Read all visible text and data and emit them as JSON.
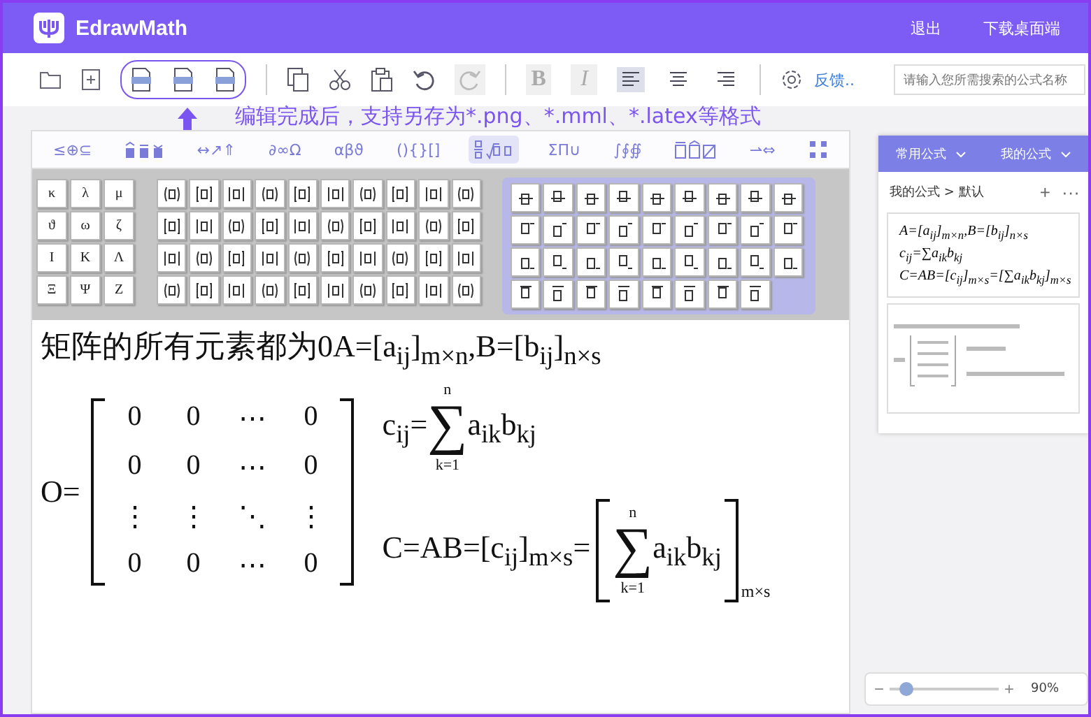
{
  "header": {
    "app_name": "EdrawMath",
    "links": [
      "退出",
      "下载桌面端"
    ]
  },
  "toolbar": {
    "redo_disabled": true,
    "text_styles": [
      {
        "label": "B",
        "disabled": true
      },
      {
        "label": "I",
        "disabled": true
      }
    ],
    "alignments": [
      {
        "kind": "left",
        "selected": true
      },
      {
        "kind": "center",
        "selected": false
      },
      {
        "kind": "right",
        "selected": false
      }
    ],
    "feedback_link": "反馈..",
    "search": {
      "placeholder": "请输入您所需搜索的公式名称"
    }
  },
  "annotation": "编辑完成后，支持另存为*.png、*.mml、*.latex等格式",
  "palette": {
    "tabs": [
      {
        "kind": "text",
        "label": "≤⊕⊆",
        "selected": false
      },
      {
        "kind": "accent",
        "selected": false
      },
      {
        "kind": "text",
        "label": "↔↗⇑",
        "selected": false
      },
      {
        "kind": "text",
        "label": "∂∞Ω",
        "selected": false
      },
      {
        "kind": "text",
        "label": "αβϑ",
        "selected": false
      },
      {
        "kind": "text",
        "label": "(){}[]",
        "selected": false
      },
      {
        "kind": "fraction",
        "selected": true
      },
      {
        "kind": "text",
        "label": "ΣΠ∪",
        "selected": false
      },
      {
        "kind": "text",
        "label": "∫∮∯",
        "selected": false
      },
      {
        "kind": "box",
        "selected": false
      },
      {
        "kind": "text",
        "label": "⇀⇔",
        "selected": false
      },
      {
        "kind": "matrix",
        "selected": false
      }
    ],
    "greek": [
      "κ",
      "λ",
      "μ",
      "ϑ",
      "ω",
      "ζ",
      "Ι",
      "Κ",
      "Λ",
      "Ξ",
      "Ψ",
      "Ζ"
    ]
  },
  "formula": {
    "line1": "矩阵的所有元素都为0A=[a$_{ij}$]$_{m×n}$,B=[b$_{ij}$]$_{n×s}$",
    "matrix_label": "O=",
    "matrix_rows": [
      [
        "0",
        "0",
        "⋯",
        "0"
      ],
      [
        "0",
        "0",
        "⋯",
        "0"
      ],
      [
        "⋮",
        "⋮",
        "⋱",
        "⋮"
      ],
      [
        "0",
        "0",
        "⋯",
        "0"
      ]
    ],
    "sum_lhs": "c$_{ij}$=",
    "sum_upper": "n",
    "sum_sign": "∑",
    "sum_lower": "k=1",
    "sum_body": "a$_{ik}$b$_{kj}$",
    "product_lhs": "C=AB=[c$_{ij}$]$_{m×s}$=",
    "product_upper": "n",
    "product_sign": "∑",
    "product_lower": "k=1",
    "product_body": "a$_{ik}$b$_{kj}$",
    "product_subscript": "m×s"
  },
  "side_panel": {
    "tabs": [
      "常用公式",
      "我的公式"
    ],
    "breadcrumb": "我的公式 > 默认",
    "add": "+",
    "more": "···",
    "thumbnail_lines": [
      "A=[a$_{ij}$]$_{m×n}$,B=[b$_{ij}$]$_{n×s}$",
      "c$_{ij}$=∑a$_{ik}$b$_{kj}$",
      "C=AB=[c$_{ij}$]$_{m×s}$=[∑a$_{ik}$b$_{kj}$]$_{m×s}$"
    ]
  },
  "zoom": {
    "minus": "−",
    "plus": "+",
    "level": 0.15,
    "value": "90%"
  }
}
